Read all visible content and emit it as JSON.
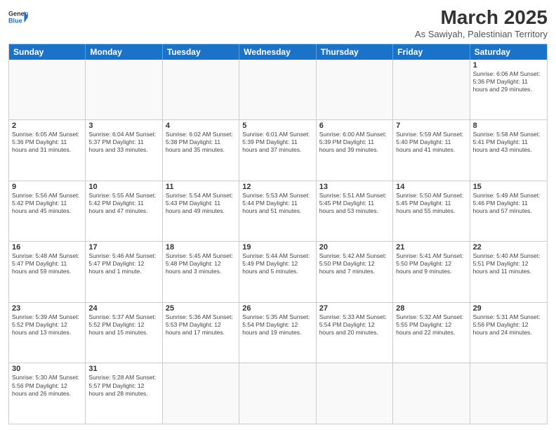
{
  "header": {
    "logo_general": "General",
    "logo_blue": "Blue",
    "month_title": "March 2025",
    "subtitle": "As Sawiyah, Palestinian Territory"
  },
  "days_of_week": [
    "Sunday",
    "Monday",
    "Tuesday",
    "Wednesday",
    "Thursday",
    "Friday",
    "Saturday"
  ],
  "weeks": [
    [
      {
        "day": "",
        "info": ""
      },
      {
        "day": "",
        "info": ""
      },
      {
        "day": "",
        "info": ""
      },
      {
        "day": "",
        "info": ""
      },
      {
        "day": "",
        "info": ""
      },
      {
        "day": "",
        "info": ""
      },
      {
        "day": "1",
        "info": "Sunrise: 6:06 AM\nSunset: 5:36 PM\nDaylight: 11 hours\nand 29 minutes."
      }
    ],
    [
      {
        "day": "2",
        "info": "Sunrise: 6:05 AM\nSunset: 5:36 PM\nDaylight: 11 hours\nand 31 minutes."
      },
      {
        "day": "3",
        "info": "Sunrise: 6:04 AM\nSunset: 5:37 PM\nDaylight: 11 hours\nand 33 minutes."
      },
      {
        "day": "4",
        "info": "Sunrise: 6:02 AM\nSunset: 5:38 PM\nDaylight: 11 hours\nand 35 minutes."
      },
      {
        "day": "5",
        "info": "Sunrise: 6:01 AM\nSunset: 5:39 PM\nDaylight: 11 hours\nand 37 minutes."
      },
      {
        "day": "6",
        "info": "Sunrise: 6:00 AM\nSunset: 5:39 PM\nDaylight: 11 hours\nand 39 minutes."
      },
      {
        "day": "7",
        "info": "Sunrise: 5:59 AM\nSunset: 5:40 PM\nDaylight: 11 hours\nand 41 minutes."
      },
      {
        "day": "8",
        "info": "Sunrise: 5:58 AM\nSunset: 5:41 PM\nDaylight: 11 hours\nand 43 minutes."
      }
    ],
    [
      {
        "day": "9",
        "info": "Sunrise: 5:56 AM\nSunset: 5:42 PM\nDaylight: 11 hours\nand 45 minutes."
      },
      {
        "day": "10",
        "info": "Sunrise: 5:55 AM\nSunset: 5:42 PM\nDaylight: 11 hours\nand 47 minutes."
      },
      {
        "day": "11",
        "info": "Sunrise: 5:54 AM\nSunset: 5:43 PM\nDaylight: 11 hours\nand 49 minutes."
      },
      {
        "day": "12",
        "info": "Sunrise: 5:53 AM\nSunset: 5:44 PM\nDaylight: 11 hours\nand 51 minutes."
      },
      {
        "day": "13",
        "info": "Sunrise: 5:51 AM\nSunset: 5:45 PM\nDaylight: 11 hours\nand 53 minutes."
      },
      {
        "day": "14",
        "info": "Sunrise: 5:50 AM\nSunset: 5:45 PM\nDaylight: 11 hours\nand 55 minutes."
      },
      {
        "day": "15",
        "info": "Sunrise: 5:49 AM\nSunset: 5:46 PM\nDaylight: 11 hours\nand 57 minutes."
      }
    ],
    [
      {
        "day": "16",
        "info": "Sunrise: 5:48 AM\nSunset: 5:47 PM\nDaylight: 11 hours\nand 59 minutes."
      },
      {
        "day": "17",
        "info": "Sunrise: 5:46 AM\nSunset: 5:47 PM\nDaylight: 12 hours\nand 1 minute."
      },
      {
        "day": "18",
        "info": "Sunrise: 5:45 AM\nSunset: 5:48 PM\nDaylight: 12 hours\nand 3 minutes."
      },
      {
        "day": "19",
        "info": "Sunrise: 5:44 AM\nSunset: 5:49 PM\nDaylight: 12 hours\nand 5 minutes."
      },
      {
        "day": "20",
        "info": "Sunrise: 5:42 AM\nSunset: 5:50 PM\nDaylight: 12 hours\nand 7 minutes."
      },
      {
        "day": "21",
        "info": "Sunrise: 5:41 AM\nSunset: 5:50 PM\nDaylight: 12 hours\nand 9 minutes."
      },
      {
        "day": "22",
        "info": "Sunrise: 5:40 AM\nSunset: 5:51 PM\nDaylight: 12 hours\nand 11 minutes."
      }
    ],
    [
      {
        "day": "23",
        "info": "Sunrise: 5:39 AM\nSunset: 5:52 PM\nDaylight: 12 hours\nand 13 minutes."
      },
      {
        "day": "24",
        "info": "Sunrise: 5:37 AM\nSunset: 5:52 PM\nDaylight: 12 hours\nand 15 minutes."
      },
      {
        "day": "25",
        "info": "Sunrise: 5:36 AM\nSunset: 5:53 PM\nDaylight: 12 hours\nand 17 minutes."
      },
      {
        "day": "26",
        "info": "Sunrise: 5:35 AM\nSunset: 5:54 PM\nDaylight: 12 hours\nand 19 minutes."
      },
      {
        "day": "27",
        "info": "Sunrise: 5:33 AM\nSunset: 5:54 PM\nDaylight: 12 hours\nand 20 minutes."
      },
      {
        "day": "28",
        "info": "Sunrise: 5:32 AM\nSunset: 5:55 PM\nDaylight: 12 hours\nand 22 minutes."
      },
      {
        "day": "29",
        "info": "Sunrise: 5:31 AM\nSunset: 5:56 PM\nDaylight: 12 hours\nand 24 minutes."
      }
    ],
    [
      {
        "day": "30",
        "info": "Sunrise: 5:30 AM\nSunset: 5:56 PM\nDaylight: 12 hours\nand 26 minutes."
      },
      {
        "day": "31",
        "info": "Sunrise: 5:28 AM\nSunset: 5:57 PM\nDaylight: 12 hours\nand 28 minutes."
      },
      {
        "day": "",
        "info": ""
      },
      {
        "day": "",
        "info": ""
      },
      {
        "day": "",
        "info": ""
      },
      {
        "day": "",
        "info": ""
      },
      {
        "day": "",
        "info": ""
      }
    ]
  ]
}
